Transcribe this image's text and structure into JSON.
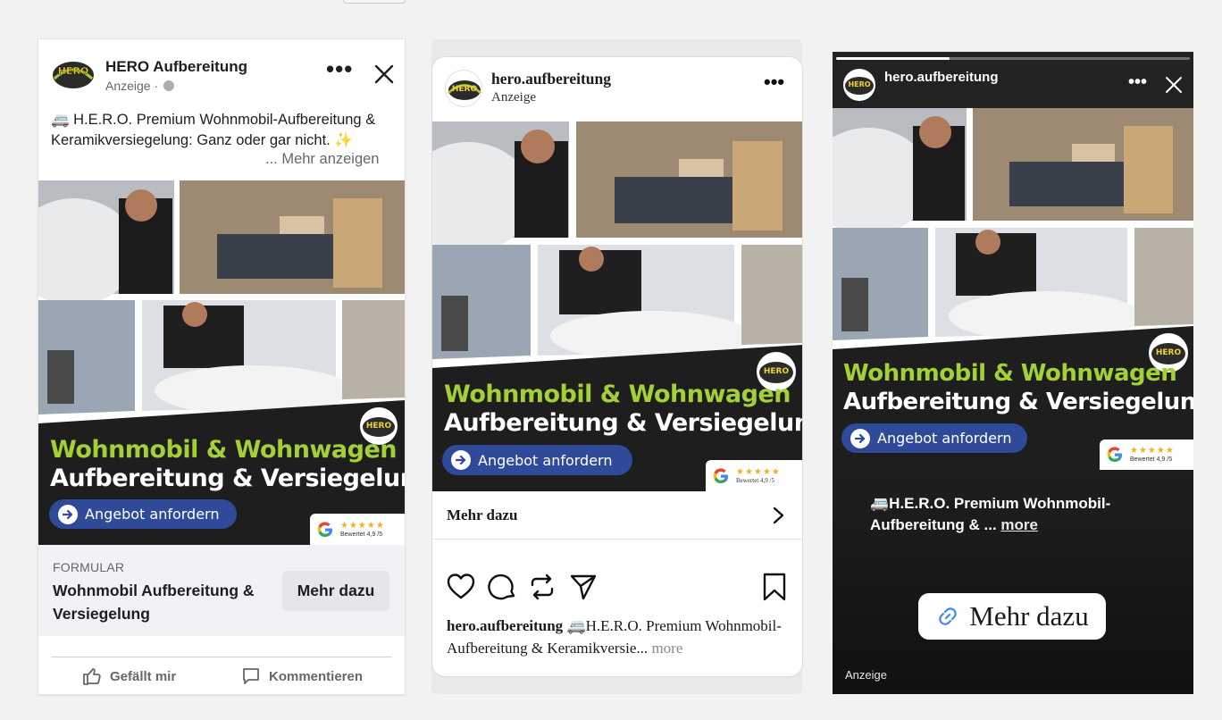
{
  "facebook": {
    "page_name": "HERO Aufbereitung",
    "sponsored": "Anzeige ·",
    "post_text": "🚐 H.E.R.O. Premium Wohnmobil-Aufbereitung & Keramikversiegelung: Ganz oder gar nicht. ✨",
    "see_more": "... Mehr anzeigen",
    "form_label": "FORMULAR",
    "form_title": "Wohnmobil Aufbereitung & Versiegelung",
    "cta_label": "Mehr dazu",
    "like_label": "Gefällt mir",
    "comment_label": "Kommentieren"
  },
  "instagram_feed": {
    "username": "hero.aufbereitung",
    "sponsored": "Anzeige",
    "cta_label": "Mehr dazu",
    "caption_user": "hero.aufbereitung",
    "caption_text": "🚐H.E.R.O. Premium Wohnmobil-Aufbereitung & Keramikversie...",
    "caption_more": "more"
  },
  "instagram_story": {
    "username": "hero.aufbereitung",
    "progress": 0.32,
    "caption": "🚐H.E.R.O. Premium Wohnmobil-Aufbereitung & ...",
    "caption_more": "more",
    "link_label": "Mehr dazu",
    "sponsored": "Anzeige"
  },
  "creative": {
    "headline_green": "Wohnmobil & Wohnwagen",
    "headline_white": "Aufbereitung & Versiegelung",
    "cta": "Angebot anfordern",
    "rating_stars": "★★★★★",
    "rating_text": "Bewertet 4,9 /5",
    "logo_text": "HERO"
  },
  "colors": {
    "banner_green": "#a4d037",
    "banner_bg": "#1e1e1e",
    "cta_blue": "#2e4a99",
    "fb_text_muted": "#65676b"
  }
}
